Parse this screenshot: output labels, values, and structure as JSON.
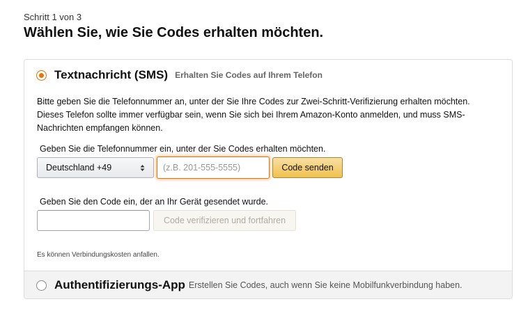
{
  "header": {
    "step": "Schritt 1 von 3",
    "title": "Wählen Sie, wie Sie Codes erhalten möchten."
  },
  "sms_option": {
    "title": "Textnachricht (SMS)",
    "subtitle": "Erhalten Sie Codes auf Ihrem Telefon",
    "selected": true,
    "description_lines": [
      "Bitte geben Sie die Telefonnummer an, unter der Sie Ihre Codes zur Zwei-Schritt-Verifizierung erhalten möchten.",
      "Dieses Telefon sollte immer verfügbar sein, wenn Sie sich bei Ihrem Amazon-Konto anmelden, und muss SMS-",
      "Nachrichten empfangen können."
    ],
    "phone_label": "Geben Sie die Telefonnummer ein, unter der Sie Codes erhalten möchten.",
    "country_value": "Deutschland +49",
    "phone_placeholder": "(z.B. 201-555-5555)",
    "send_button": "Code senden",
    "code_label": "Geben Sie den Code ein, der an Ihr Gerät gesendet wurde.",
    "verify_button": "Code verifizieren und fortfahren",
    "note": "Es können Verbindungskosten anfallen."
  },
  "app_option": {
    "title": "Authentifizierungs-App",
    "subtitle": "Erstellen Sie Codes, auch wenn Sie keine Mobilfunkverbindung haben.",
    "selected": false
  },
  "colors": {
    "accent_orange": "#e77600",
    "button_yellow": "#f0c14b",
    "panel_footer_bg": "#f3f3f3"
  }
}
